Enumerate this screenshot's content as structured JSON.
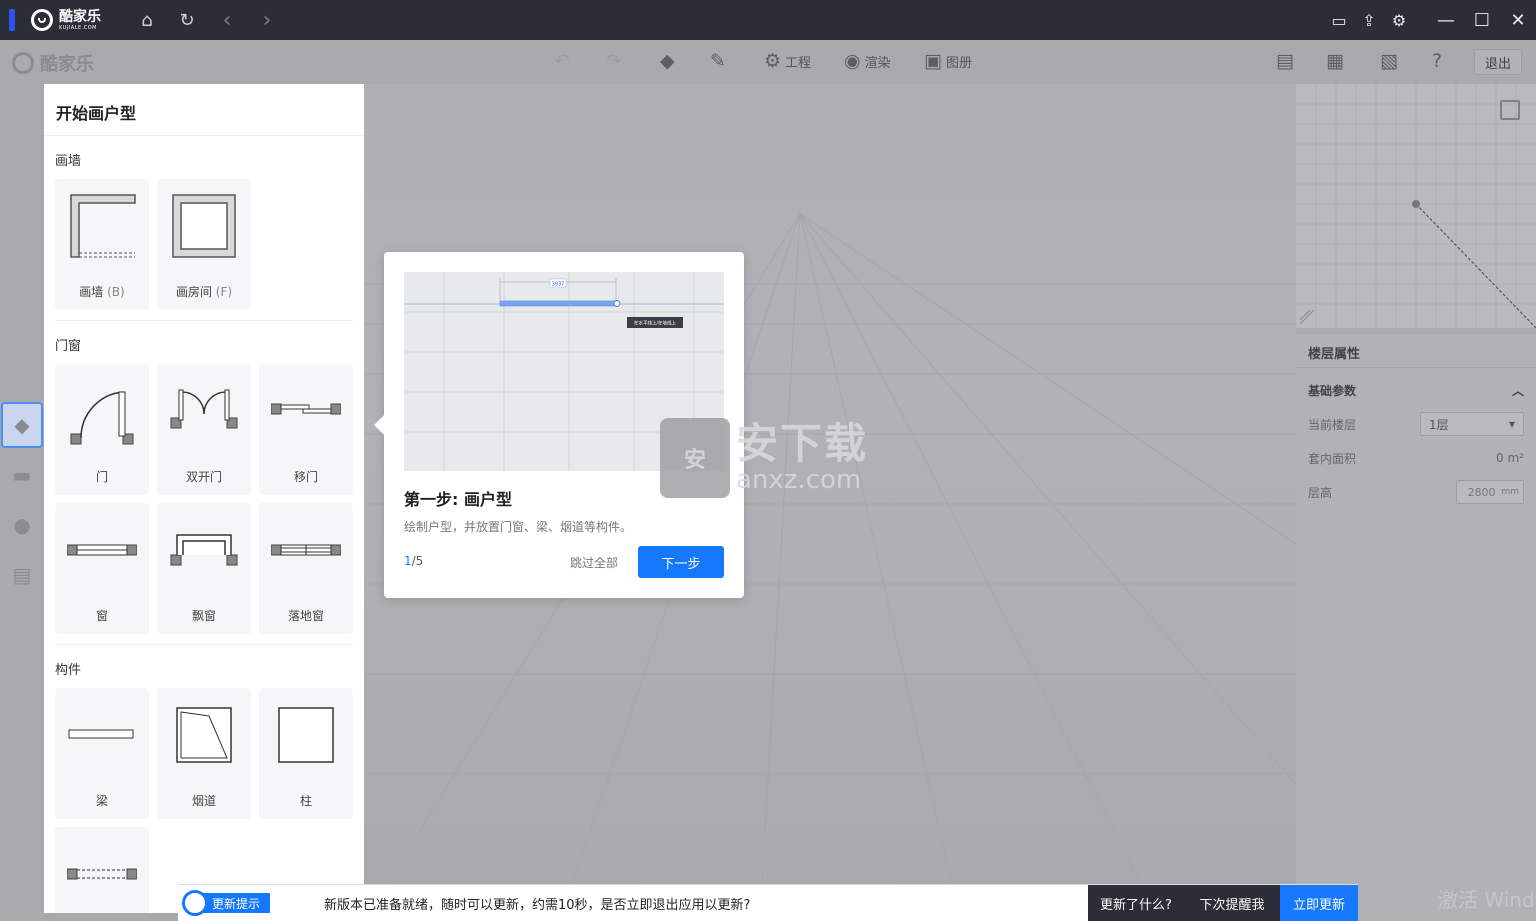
{
  "titlebar": {
    "app_name": "酷家乐",
    "app_name_en": "KUJIALE.COM"
  },
  "toolbar": {
    "logo_text": "酷家乐",
    "project_label": "工程",
    "render_label": "渲染",
    "album_label": "图册",
    "exit_label": "退出"
  },
  "panel": {
    "title": "开始画户型",
    "sections": [
      {
        "label": "画墙",
        "items": [
          {
            "label": "画墙",
            "key": "(B)"
          },
          {
            "label": "画房间",
            "key": "(F)"
          }
        ]
      },
      {
        "label": "门窗",
        "items": [
          {
            "label": "门"
          },
          {
            "label": "双开门"
          },
          {
            "label": "移门"
          },
          {
            "label": "窗"
          },
          {
            "label": "飘窗"
          },
          {
            "label": "落地窗"
          }
        ]
      },
      {
        "label": "构件",
        "items": [
          {
            "label": "梁"
          },
          {
            "label": "烟道"
          },
          {
            "label": "柱"
          },
          {
            "label": ""
          }
        ]
      }
    ]
  },
  "guide": {
    "title": "第一步: 画户型",
    "description": "绘制户型，并放置门窗、梁、烟道等构件。",
    "page_current": "1",
    "page_total": "/5",
    "skip_label": "跳过全部",
    "next_label": "下一步",
    "preview_dim": "3937",
    "preview_tip": "在水平线上/在墙线上"
  },
  "watermark": {
    "title": "安下载",
    "domain": "anxz.com",
    "bag_char": "安"
  },
  "props": {
    "title": "楼层属性",
    "subtitle": "基础参数",
    "current_floor_label": "当前楼层",
    "current_floor_value": "1层",
    "area_label": "套内面积",
    "area_value": "0 m²",
    "height_label": "层高",
    "height_value": "2800",
    "height_unit": "mm"
  },
  "update": {
    "tag": "更新提示",
    "message": "新版本已准备就绪，随时可以更新，约需10秒，是否立即退出应用以更新?",
    "whats_new": "更新了什么?",
    "remind_later": "下次提醒我",
    "update_now": "立即更新"
  },
  "activate_text": "激活 Wind",
  "colors": {
    "titlebar": "#2b2e37",
    "accent": "#1677ff",
    "panel": "#ffffff",
    "canvas": "#aeb0b3"
  }
}
